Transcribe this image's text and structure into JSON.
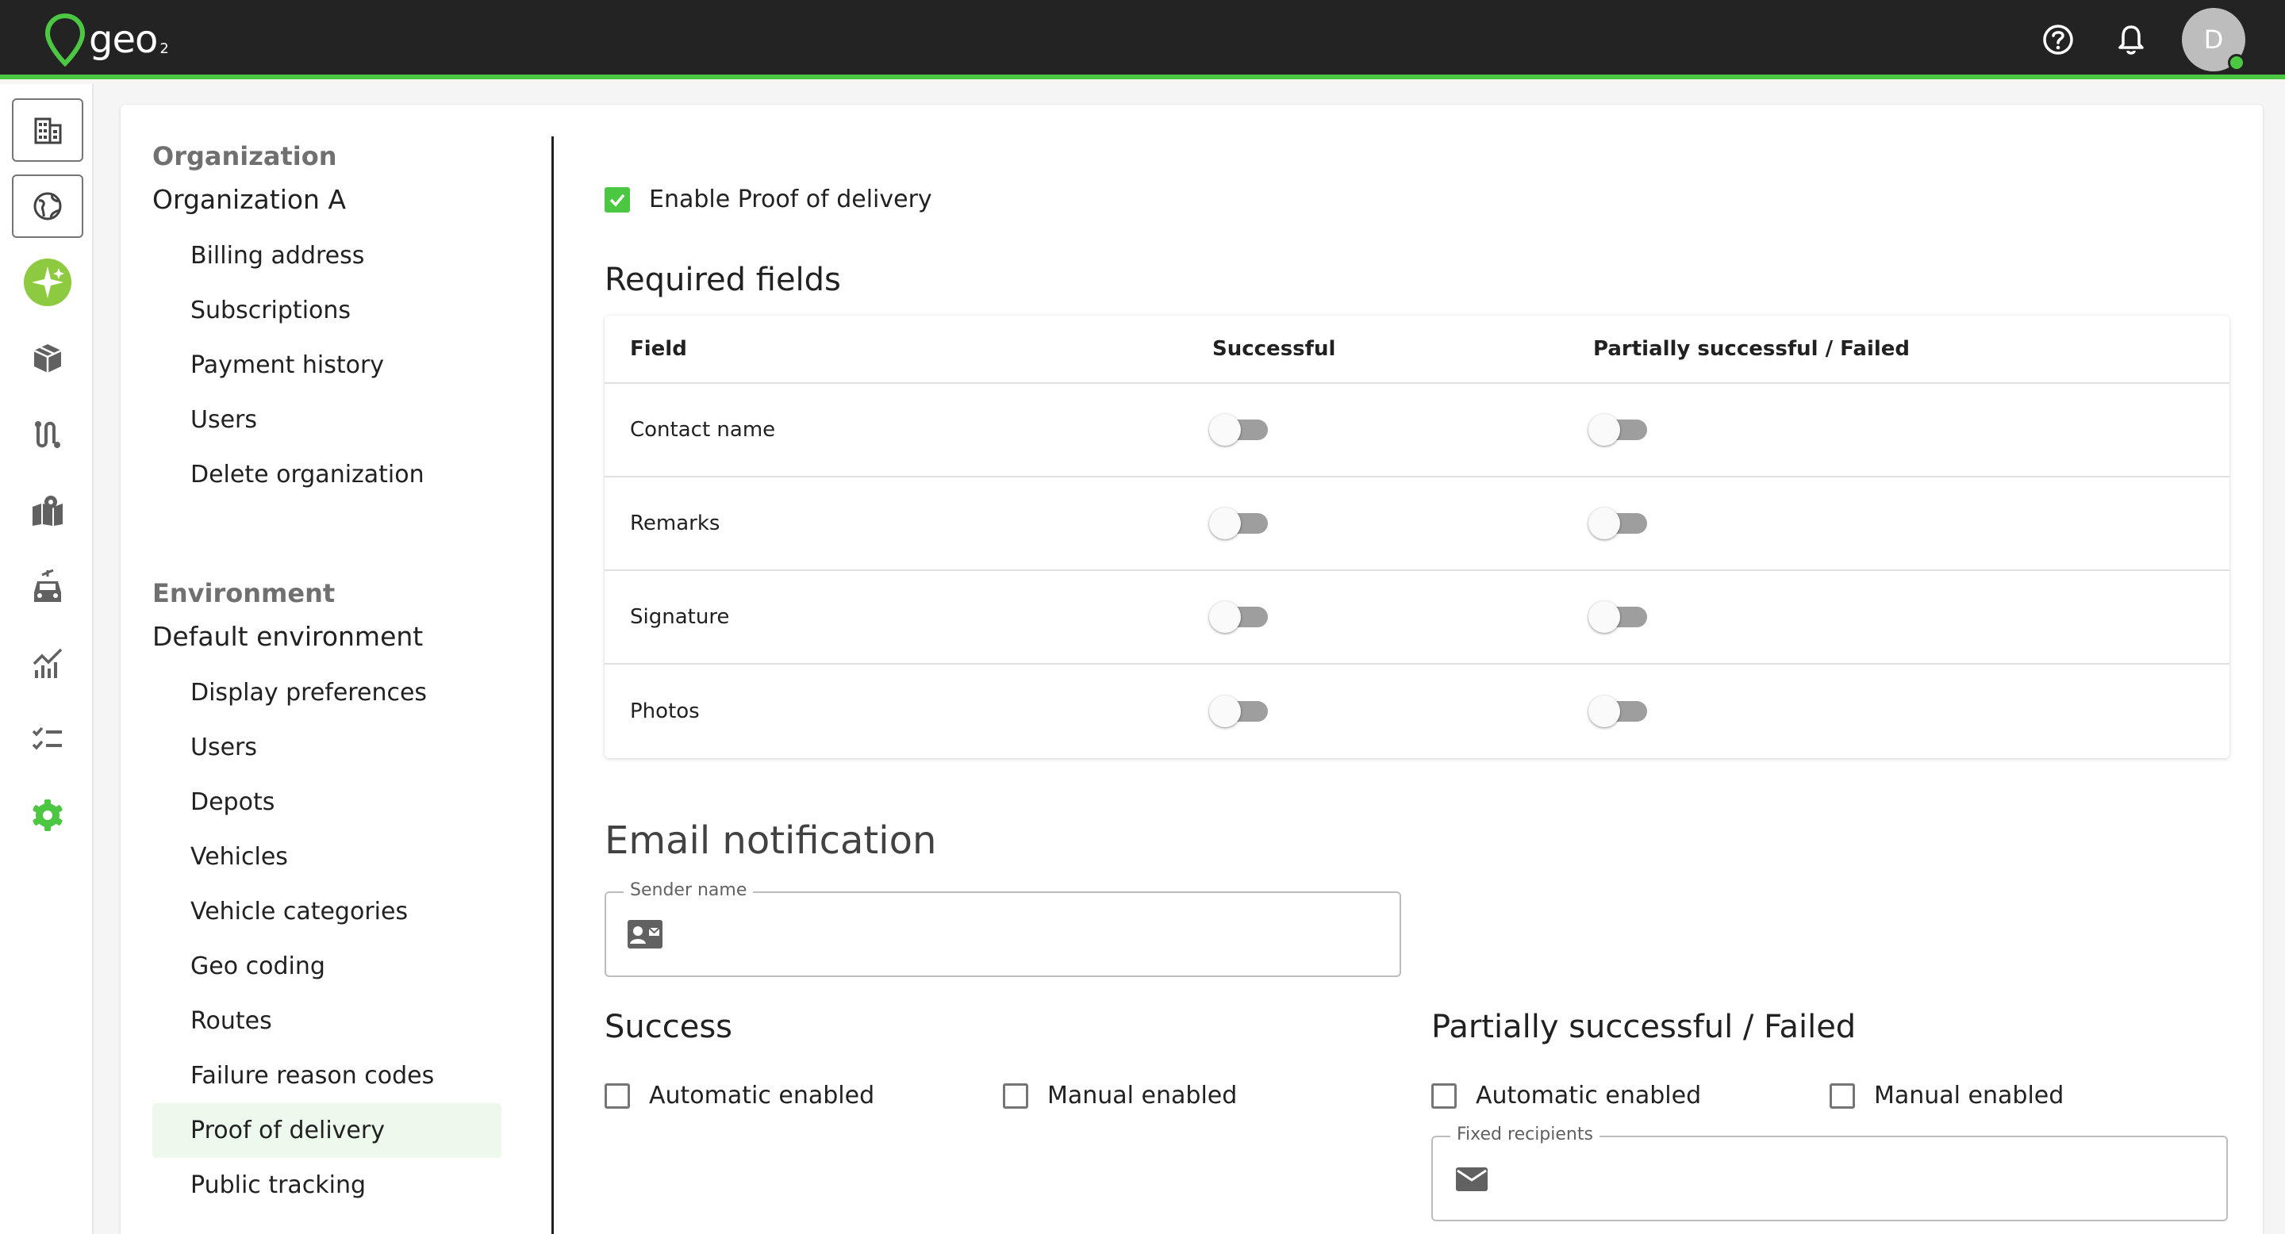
{
  "app": {
    "logo_text": "geo",
    "logo_sub": "2",
    "avatar_initial": "D",
    "accent_color": "#4cc742"
  },
  "rail": {
    "icons": [
      "building-icon",
      "globe-icon",
      "sparkle-icon",
      "package-icon",
      "route-icon",
      "map-icon",
      "vehicle-icon",
      "analytics-icon",
      "checklist-icon",
      "settings-gear-icon"
    ],
    "active": "settings-gear-icon"
  },
  "nav": {
    "org_section": "Organization",
    "org_name": "Organization A",
    "org_items": [
      "Billing address",
      "Subscriptions",
      "Payment history",
      "Users",
      "Delete organization"
    ],
    "env_section": "Environment",
    "env_name": "Default environment",
    "env_items": [
      "Display preferences",
      "Users",
      "Depots",
      "Vehicles",
      "Vehicle categories",
      "Geo coding",
      "Routes",
      "Failure reason codes",
      "Proof of delivery",
      "Public tracking"
    ],
    "active_item": "Proof of delivery"
  },
  "pod": {
    "enable_label": "Enable Proof of delivery",
    "enable_checked": true,
    "required_title": "Required fields",
    "table": {
      "headers": [
        "Field",
        "Successful",
        "Partially successful / Failed"
      ],
      "rows": [
        {
          "field": "Contact name",
          "successful": false,
          "failed": false
        },
        {
          "field": "Remarks",
          "successful": false,
          "failed": false
        },
        {
          "field": "Signature",
          "successful": false,
          "failed": false
        },
        {
          "field": "Photos",
          "successful": false,
          "failed": false
        }
      ]
    },
    "email_title": "Email notification",
    "sender_label": "Sender name",
    "sender_value": "",
    "success_title": "Success",
    "failed_title": "Partially successful / Failed",
    "automatic_label": "Automatic enabled",
    "manual_label": "Manual enabled",
    "success_automatic": false,
    "success_manual": false,
    "failed_automatic": false,
    "failed_manual": false,
    "recipients_label": "Fixed recipients",
    "recipients_value": ""
  }
}
